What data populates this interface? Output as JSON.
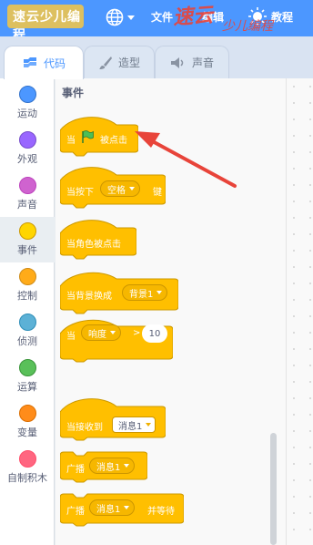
{
  "menubar": {
    "logo_text": "速云少儿编程",
    "file_label": "文件",
    "edit_label": "编辑",
    "tutorial_label": "教程",
    "watermark": "速云",
    "watermark_sub": "少儿编程"
  },
  "tabs": [
    {
      "label": "代码",
      "icon": "code-icon"
    },
    {
      "label": "造型",
      "icon": "brush-icon"
    },
    {
      "label": "声音",
      "icon": "speaker-icon"
    }
  ],
  "categories": [
    {
      "label": "运动",
      "color": "#4c97ff"
    },
    {
      "label": "外观",
      "color": "#9966ff"
    },
    {
      "label": "声音",
      "color": "#cf63cf"
    },
    {
      "label": "事件",
      "color": "#ffd500"
    },
    {
      "label": "控制",
      "color": "#ffab19"
    },
    {
      "label": "侦测",
      "color": "#5cb1d6"
    },
    {
      "label": "运算",
      "color": "#59c059"
    },
    {
      "label": "变量",
      "color": "#ff8c1a"
    },
    {
      "label": "自制积木",
      "color": "#ff6680"
    }
  ],
  "flyout": {
    "section_title": "事件",
    "blocks": {
      "flag_when": "当",
      "flag_clicked": "被点击",
      "key_when": "当按下",
      "key_value": "空格",
      "key_suffix": "键",
      "sprite_clicked": "当角色被点击",
      "backdrop_when": "当背景换成",
      "backdrop_value": "背景1",
      "sensor_when": "当",
      "sensor_value": "响度",
      "sensor_op": ">",
      "sensor_number": "10",
      "receive_when": "当接收到",
      "receive_value": "消息1",
      "broadcast_label": "广播",
      "broadcast_value": "消息1",
      "broadcast_wait_label": "广播",
      "broadcast_wait_value": "消息1",
      "broadcast_wait_suffix": "并等待"
    }
  },
  "colors": {
    "menubar": "#4c97ff",
    "events_block": "#ffbf00",
    "annotation_arrow": "#e8443a"
  }
}
